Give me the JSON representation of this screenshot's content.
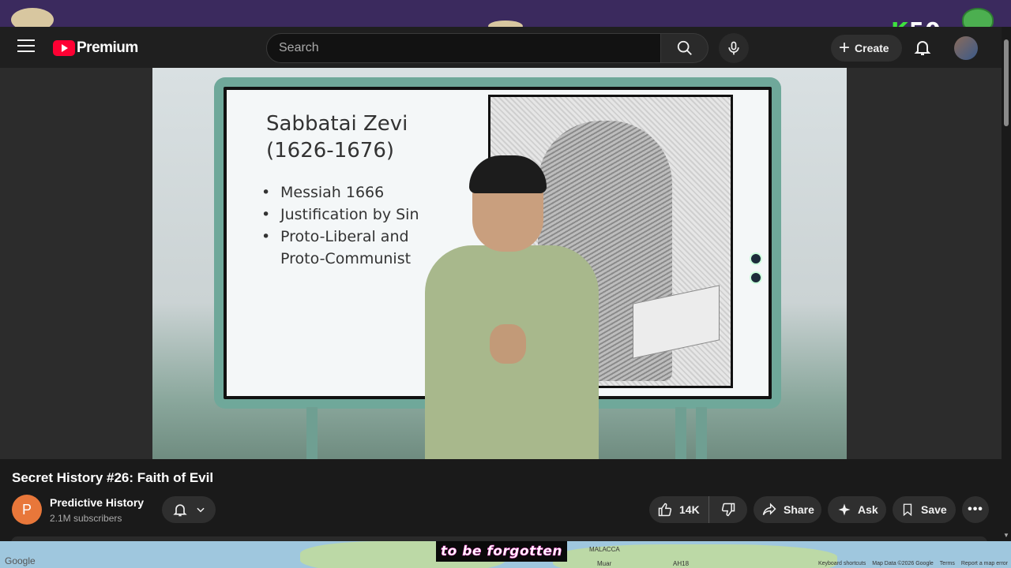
{
  "header": {
    "logo_text": "Premium",
    "search_placeholder": "Search",
    "create_label": "Create"
  },
  "stream_overlay": {
    "k50_k": "K",
    "k50_num": "50"
  },
  "slide": {
    "title_line1": "Sabbatai Zevi",
    "title_line2": "(1626-1676)",
    "bullets": [
      "Messiah 1666",
      "Justification by Sin",
      "Proto-Liberal and",
      "Proto-Communist"
    ]
  },
  "video": {
    "title": "Secret History #26: Faith of Evil",
    "channel_initial": "P",
    "channel_name": "Predictive History",
    "subscribers": "2.1M subscribers",
    "likes": "14K",
    "share_label": "Share",
    "ask_label": "Ask",
    "save_label": "Save",
    "more_label": "•••"
  },
  "map": {
    "google": "Google",
    "label_malacca": "MALACCA",
    "label_muar": "Muar",
    "label_road": "AH18",
    "footer": [
      "Keyboard shortcuts",
      "Map Data ©2026 Google",
      "Terms",
      "Report a map error"
    ]
  },
  "caption": "to be forgotten",
  "colors": {
    "brand": "#ff0033",
    "accent_green": "#3ee23e",
    "caption_outline": "#ff4fd8"
  }
}
